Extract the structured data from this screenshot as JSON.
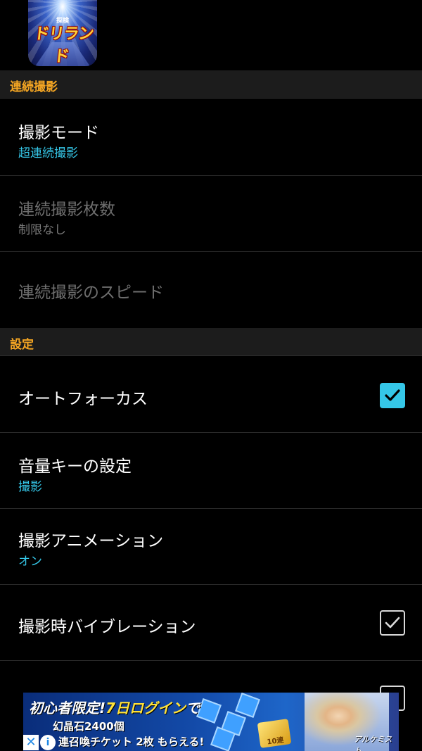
{
  "app": {
    "icon_name": "app-icon",
    "logo_small": "探検",
    "logo_text": "ドリランド"
  },
  "sections": {
    "burst": {
      "title": "連続撮影"
    },
    "settings": {
      "title": "設定"
    }
  },
  "rows": {
    "mode": {
      "title": "撮影モード",
      "summary": "超連続撮影"
    },
    "count": {
      "title": "連続撮影枚数",
      "summary": "制限なし"
    },
    "speed": {
      "title": "連続撮影のスピード"
    },
    "autofocus": {
      "title": "オートフォーカス",
      "checked": true
    },
    "volume": {
      "title": "音量キーの設定",
      "summary": "撮影"
    },
    "animation": {
      "title": "撮影アニメーション",
      "summary": "オン"
    },
    "vibration": {
      "title": "撮影時バイブレーション",
      "checked": true
    }
  },
  "ad": {
    "headline_a": "初心者限定!",
    "headline_b": "7日ログイン",
    "headline_c": "で",
    "line2": "幻晶石2400個",
    "line3": "連召喚チケット 2枚 もらえる!",
    "gold_label": "10連",
    "brand": "アルケミスト",
    "close_symbol": "✕",
    "info_symbol": "i"
  },
  "colors": {
    "accent": "#35c7e8",
    "section_header": "#f5a623",
    "background": "#000000"
  }
}
